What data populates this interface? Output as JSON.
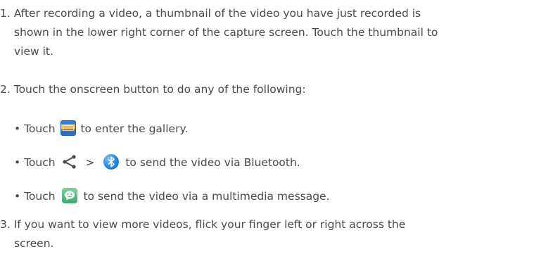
{
  "steps": [
    {
      "number": "1.",
      "text_line1": "After recording a video, a thumbnail of the video you have just recorded is",
      "text_line2": "shown in the lower right corner of the capture screen. Touch the thumbnail to",
      "text_line3": "view it."
    },
    {
      "number": "2.",
      "text": "Touch the onscreen button to do any of the following:",
      "bullets": [
        {
          "marker": "•",
          "before": "Touch",
          "icon": "gallery-icon",
          "after": "to enter the gallery."
        },
        {
          "marker": "•",
          "before": "Touch",
          "icon": "share-icon",
          "separator": ">",
          "icon2": "bluetooth-icon",
          "after": "to send the video via Bluetooth."
        },
        {
          "marker": "•",
          "before": "Touch",
          "icon": "message-icon",
          "after": "to send the video via a multimedia message."
        }
      ]
    },
    {
      "number": "3.",
      "text_line1": "If you want to view more videos, flick your finger left or right across the",
      "text_line2": "screen."
    }
  ]
}
